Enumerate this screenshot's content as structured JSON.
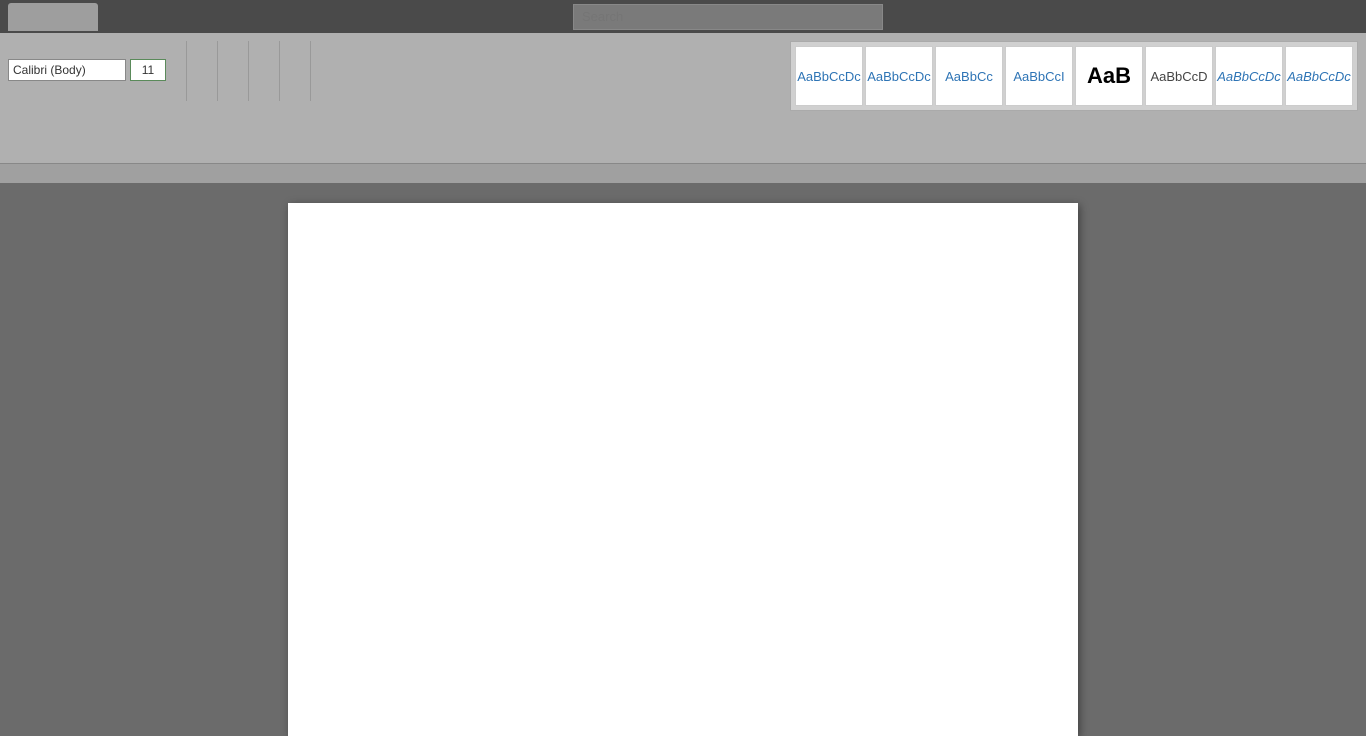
{
  "titlebar": {
    "tab_label": ""
  },
  "search": {
    "placeholder": "Search",
    "value": "Search"
  },
  "ribbon": {
    "font_name": "Calibri (Body)",
    "font_size": "11",
    "divider_count": 5
  },
  "styles": {
    "items": [
      {
        "id": "style-1",
        "label": "AaBbCcDc",
        "class": "style-1"
      },
      {
        "id": "style-2",
        "label": "AaBbCcDc",
        "class": "style-2"
      },
      {
        "id": "style-3",
        "label": "AaBbCc",
        "class": "style-3"
      },
      {
        "id": "style-4",
        "label": "AaBbCcI",
        "class": "style-4"
      },
      {
        "id": "style-5",
        "label": "AaB",
        "class": "style-5"
      },
      {
        "id": "style-6",
        "label": "AaBbCcD",
        "class": "style-6"
      },
      {
        "id": "style-7",
        "label": "AaBbCcDc",
        "class": "style-7"
      },
      {
        "id": "style-8",
        "label": "AaBbCcDc",
        "class": "style-8"
      }
    ]
  }
}
